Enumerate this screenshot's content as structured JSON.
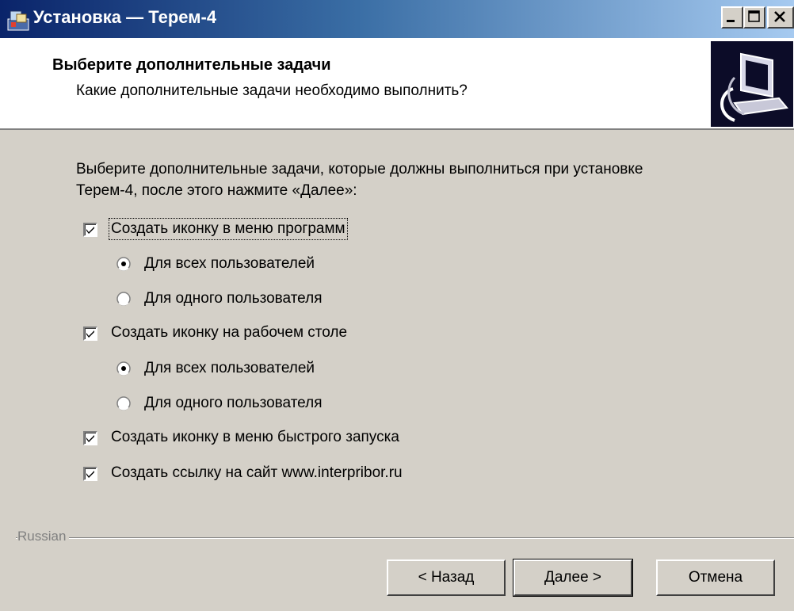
{
  "window": {
    "title": "Установка — Терем-4",
    "controls": {
      "minimize": "_",
      "maximize": "□",
      "close": "×"
    }
  },
  "header": {
    "title": "Выберите дополнительные задачи",
    "subtitle": "Какие дополнительные задачи необходимо выполнить?"
  },
  "body": {
    "description_line1": "Выберите дополнительные задачи, которые должны выполниться при установке",
    "description_line2": "Терем-4, после этого нажмите «Далее»:"
  },
  "tasks": [
    {
      "label": "Создать иконку в меню программ",
      "checked": true
    },
    {
      "label": "Для всех пользователей",
      "selected": true
    },
    {
      "label": "Для одного пользователя",
      "selected": false
    },
    {
      "label": "Создать иконку на рабочем столе",
      "checked": true
    },
    {
      "label": "Для всех пользователей",
      "selected": true
    },
    {
      "label": "Для одного пользователя",
      "selected": false
    },
    {
      "label": "Создать иконку в меню быстрого запуска",
      "checked": true
    },
    {
      "label": "Создать ссылку на сайт www.interpribor.ru",
      "checked": true
    }
  ],
  "language_label": "Russian",
  "buttons": {
    "back": "< Назад",
    "next": "Далее >",
    "cancel": "Отмена"
  },
  "icons": {
    "app": "installer-icon",
    "wizard": "computer-install-icon",
    "checkbox": "checkmark-icon",
    "radio": "radio-dot-icon"
  },
  "colors": {
    "titlebar_start": "#0a246a",
    "titlebar_end": "#a6caf0",
    "dialog_bg": "#d4d0c8",
    "header_bg": "#ffffff"
  }
}
